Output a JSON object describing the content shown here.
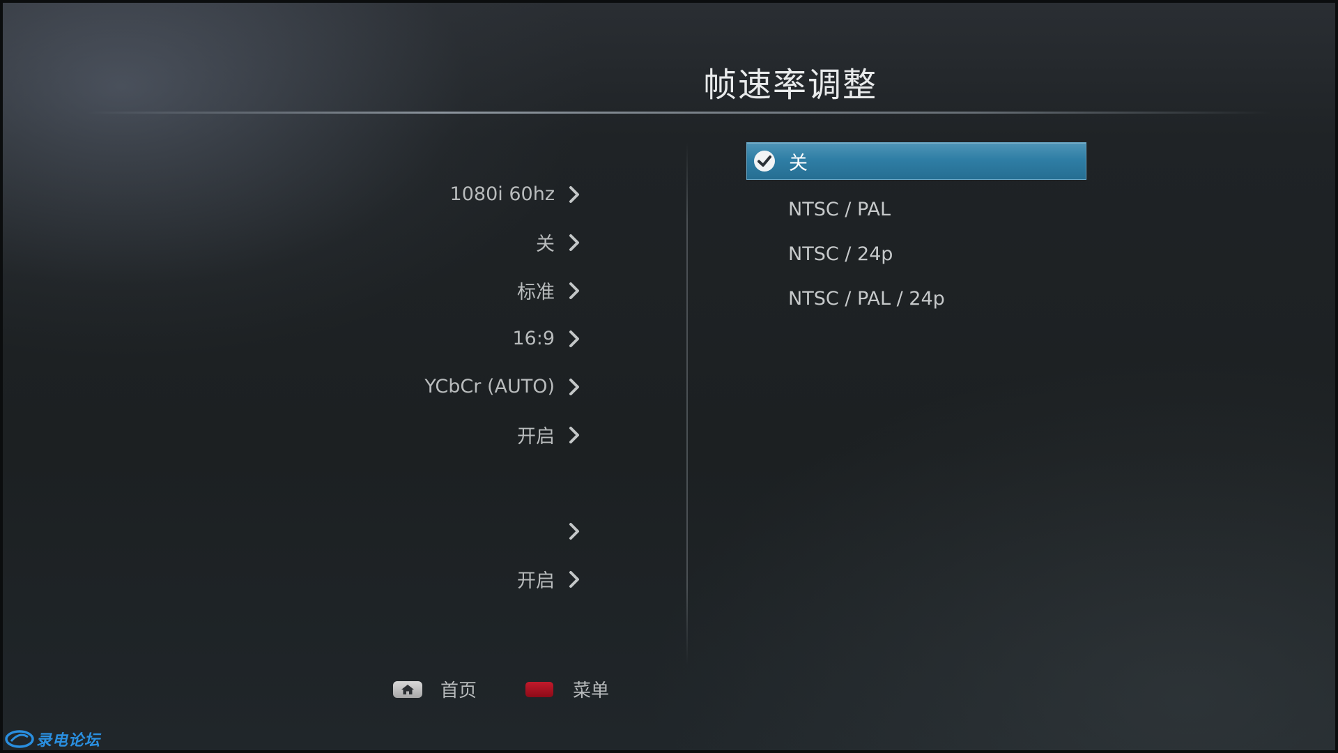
{
  "header": {
    "title": "帧速率调整"
  },
  "left_panel": {
    "items": [
      {
        "value": "1080i 60hz"
      },
      {
        "value": "关"
      },
      {
        "value": "标准"
      },
      {
        "value": "16:9"
      },
      {
        "value": "YCbCr (AUTO)"
      },
      {
        "value": "开启"
      },
      {
        "value": ""
      },
      {
        "value": ""
      },
      {
        "value": "开启"
      }
    ]
  },
  "options": {
    "selected_index": 0,
    "items": [
      {
        "label": "关"
      },
      {
        "label": "NTSC / PAL"
      },
      {
        "label": "NTSC / 24p"
      },
      {
        "label": "NTSC / PAL / 24p"
      }
    ]
  },
  "footer": {
    "home_label": "首页",
    "menu_label": "菜单"
  },
  "watermark": {
    "text": "录电论坛"
  },
  "colors": {
    "highlight": "#2f7ea5",
    "red_button": "#c11a2b"
  },
  "icons": {
    "chevron": "chevron-right-icon",
    "check": "check-circle-icon",
    "home": "home-icon"
  }
}
